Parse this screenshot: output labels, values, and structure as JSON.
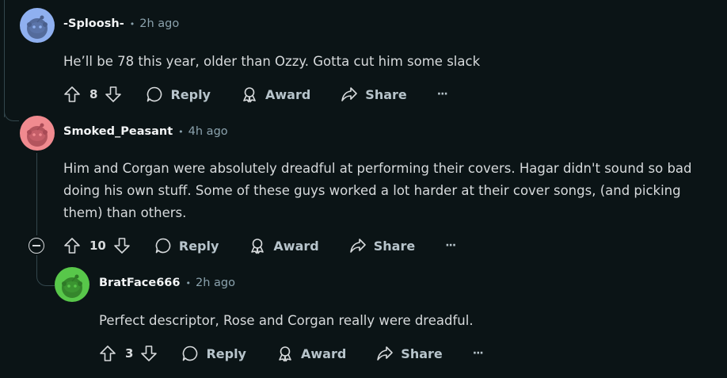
{
  "comments": [
    {
      "author": "-Sploosh-",
      "time": "2h ago",
      "body": "He’ll be 78 this year, older than Ozzy. Gotta cut him some slack",
      "votes": "8",
      "avatar_color": "#8fb0f0",
      "reply_label": "Reply",
      "award_label": "Award",
      "share_label": "Share",
      "more_label": "···"
    },
    {
      "author": "Smoked_Peasant",
      "time": "4h ago",
      "body": "Him and Corgan were absolutely dreadful at performing their covers. Hagar didn't sound so bad doing his own stuff. Some of these guys worked a lot harder at their cover songs, (and picking them) than others.",
      "votes": "10",
      "avatar_color": "#f08a8f",
      "reply_label": "Reply",
      "award_label": "Award",
      "share_label": "Share",
      "more_label": "···"
    },
    {
      "author": "BratFace666",
      "time": "2h ago",
      "body": "Perfect descriptor, Rose and Corgan really were dreadful.",
      "votes": "3",
      "avatar_color": "#58c74a",
      "reply_label": "Reply",
      "award_label": "Award",
      "share_label": "Share",
      "more_label": "···"
    }
  ],
  "separator": "•",
  "colors": {
    "background": "#0b1416",
    "text": "#d7dadc",
    "meta": "#8ba2ad",
    "thread_line": "#33464c"
  },
  "icons": [
    "upvote-icon",
    "downvote-icon",
    "comment-bubble-icon",
    "award-icon",
    "share-arrow-icon",
    "more-dots-icon",
    "collapse-minus-icon",
    "snoo-avatar-icon"
  ]
}
